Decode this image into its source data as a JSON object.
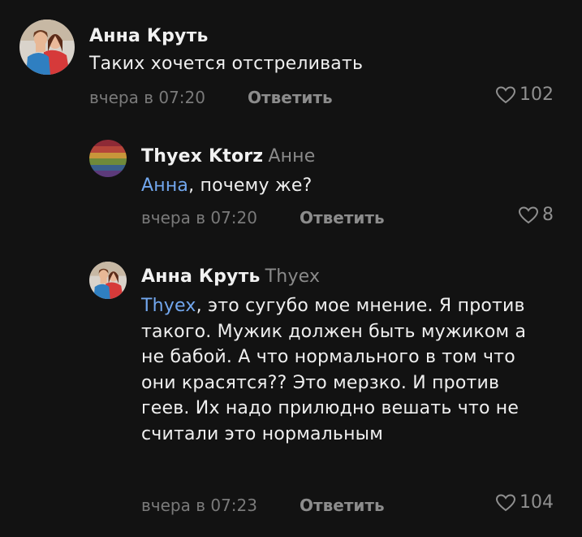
{
  "comments": [
    {
      "author": "Анна Круть",
      "reply_to": "",
      "mention": "",
      "text": "Таких хочется отстреливать",
      "time": "вчера в 07:20",
      "reply_label": "Ответить",
      "likes": "102",
      "avatar": "photo-avatar-couple"
    },
    {
      "author": "Thyex Ktorz",
      "reply_to": "Анне",
      "mention": "Анна",
      "text": ", почему же?",
      "time": "вчера в 07:20",
      "reply_label": "Ответить",
      "likes": "8",
      "avatar": "rainbow-avatar"
    },
    {
      "author": "Анна Круть",
      "reply_to": "Thyex",
      "mention": "Thyex",
      "text": ", это сугубо мое мнение. Я против такого. Мужик должен быть мужиком а не бабой. А что нормального в том что они красятся?? Это мерзко. И против геев. Их надо прилюдно вешать что не считали это нормальным",
      "time": "вчера в 07:23",
      "reply_label": "Ответить",
      "likes": "104",
      "avatar": "photo-avatar-couple"
    }
  ],
  "colors": {
    "background": "#121212",
    "mention": "#72a7ee",
    "secondary_text": "#7a7a7a"
  }
}
